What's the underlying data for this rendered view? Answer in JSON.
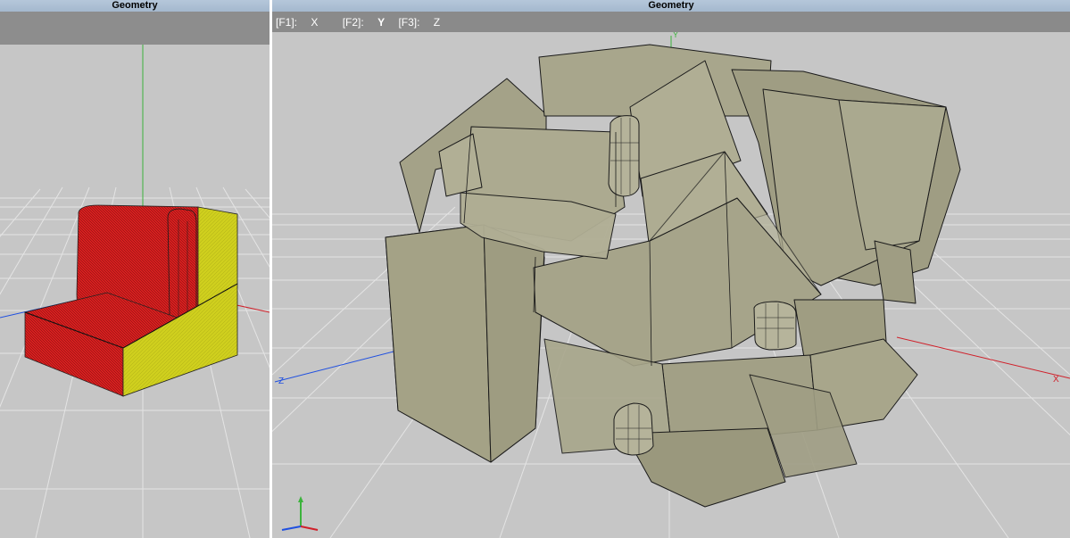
{
  "left_view": {
    "title": "Geometry"
  },
  "right_view": {
    "title": "Geometry",
    "axis_buttons": [
      {
        "key": "[F1]:",
        "axis": "X"
      },
      {
        "key": "[F2]:",
        "axis": "Y"
      },
      {
        "key": "[F3]:",
        "axis": "Z"
      }
    ],
    "active_axis": "Y"
  },
  "axis_labels": {
    "x": "X",
    "y": "Y",
    "z": "Z"
  },
  "colors": {
    "viewport_bg": "#c6c6c6",
    "title_bar": "#a9bcd1",
    "x_axis": "#d0202a",
    "y_axis": "#3cb33c",
    "z_axis": "#2050e0",
    "red_face": "#d81f1f",
    "yellow_face": "#cfcf1e",
    "solid_olive": "#a7a58a"
  }
}
